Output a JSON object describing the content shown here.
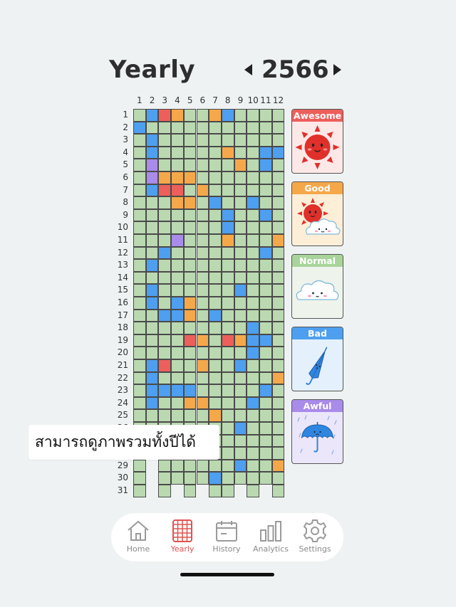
{
  "header": {
    "title": "Yearly",
    "year": "2566"
  },
  "colors": {
    "awesome": "#ed5f5b",
    "good": "#f5a84a",
    "normal": "#a8d49b",
    "bad": "#4e9ff0",
    "awful": "#a98bea",
    "cell_default": "#bad9b1"
  },
  "grid": {
    "month_labels": [
      "1",
      "2",
      "3",
      "4",
      "5",
      "6",
      "7",
      "8",
      "9",
      "10",
      "11",
      "12"
    ],
    "day_labels": [
      "1",
      "2",
      "3",
      "4",
      "5",
      "6",
      "7",
      "8",
      "9",
      "10",
      "11",
      "12",
      "13",
      "14",
      "15",
      "16",
      "17",
      "18",
      "19",
      "20",
      "21",
      "22",
      "23",
      "24",
      "25",
      "26",
      "27",
      "28",
      "29",
      "30",
      "31"
    ],
    "days_in_month": [
      31,
      28,
      31,
      30,
      31,
      30,
      31,
      31,
      30,
      31,
      30,
      31
    ],
    "moods": [
      [
        "G",
        "B",
        "G",
        "G",
        "G",
        "G",
        "G",
        "G",
        "G",
        "G",
        "G",
        "G",
        "G",
        "G",
        "G",
        "G",
        "G",
        "G",
        "G",
        "G",
        "G",
        "G",
        "G",
        "G",
        "G",
        "G",
        "G",
        "G",
        "G",
        "G",
        "G"
      ],
      [
        "B",
        "G",
        "B",
        "B",
        "P",
        "P",
        "B",
        "G",
        "G",
        "G",
        "G",
        "G",
        "B",
        "G",
        "B",
        "B",
        "G",
        "G",
        "G",
        "G",
        "B",
        "B",
        "B",
        "B",
        "G",
        "G",
        "G",
        "G",
        "B",
        "B",
        "G"
      ],
      [
        "A",
        "G",
        "G",
        "G",
        "G",
        "O",
        "A",
        "G",
        "G",
        "G",
        "G",
        "B",
        "G",
        "G",
        "G",
        "G",
        "B",
        "G",
        "G",
        "G",
        "A",
        "G",
        "B",
        "G",
        "G",
        "G",
        "G",
        "G",
        "G",
        "G",
        "G"
      ],
      [
        "O",
        "G",
        "G",
        "G",
        "G",
        "O",
        "A",
        "O",
        "G",
        "G",
        "P",
        "G",
        "G",
        "G",
        "G",
        "B",
        "B",
        "G",
        "G",
        "G",
        "G",
        "G",
        "B",
        "G",
        "G",
        "G",
        "G",
        "G",
        "G",
        "G",
        "G"
      ],
      [
        "G",
        "G",
        "G",
        "G",
        "G",
        "O",
        "G",
        "O",
        "G",
        "G",
        "G",
        "G",
        "G",
        "G",
        "G",
        "O",
        "O",
        "G",
        "A",
        "G",
        "G",
        "G",
        "B",
        "O",
        "G",
        "G",
        "G",
        "G",
        "G",
        "G",
        "G"
      ],
      [
        "G",
        "G",
        "G",
        "G",
        "G",
        "G",
        "O",
        "G",
        "G",
        "G",
        "G",
        "G",
        "G",
        "G",
        "G",
        "G",
        "G",
        "G",
        "O",
        "G",
        "O",
        "G",
        "G",
        "O",
        "G",
        "G",
        "G",
        "G",
        "G",
        "G",
        "G"
      ],
      [
        "O",
        "G",
        "G",
        "G",
        "G",
        "G",
        "G",
        "B",
        "G",
        "G",
        "G",
        "G",
        "G",
        "G",
        "G",
        "G",
        "B",
        "G",
        "G",
        "G",
        "G",
        "G",
        "G",
        "G",
        "O",
        "G",
        "G",
        "G",
        "G",
        "B",
        "G"
      ],
      [
        "B",
        "G",
        "G",
        "O",
        "G",
        "G",
        "G",
        "G",
        "B",
        "B",
        "O",
        "G",
        "G",
        "G",
        "G",
        "G",
        "G",
        "G",
        "A",
        "G",
        "G",
        "G",
        "G",
        "G",
        "G",
        "G",
        "G",
        "G",
        "G",
        "G",
        "G"
      ],
      [
        "G",
        "G",
        "G",
        "G",
        "O",
        "G",
        "G",
        "G",
        "G",
        "G",
        "G",
        "G",
        "G",
        "G",
        "B",
        "G",
        "G",
        "G",
        "O",
        "G",
        "B",
        "G",
        "G",
        "G",
        "G",
        "B",
        "G",
        "G",
        "B",
        "G",
        "G"
      ],
      [
        "G",
        "G",
        "G",
        "G",
        "G",
        "G",
        "G",
        "B",
        "G",
        "G",
        "G",
        "G",
        "G",
        "G",
        "G",
        "G",
        "G",
        "B",
        "B",
        "B",
        "G",
        "G",
        "G",
        "B",
        "G",
        "G",
        "G",
        "G",
        "G",
        "G",
        "G"
      ],
      [
        "G",
        "G",
        "G",
        "B",
        "B",
        "G",
        "G",
        "G",
        "B",
        "G",
        "G",
        "B",
        "G",
        "G",
        "G",
        "G",
        "G",
        "G",
        "B",
        "G",
        "G",
        "G",
        "B",
        "G",
        "G",
        "G",
        "G",
        "G",
        "G",
        "G",
        "G"
      ],
      [
        "G",
        "G",
        "G",
        "B",
        "G",
        "G",
        "G",
        "G",
        "G",
        "G",
        "O",
        "G",
        "G",
        "G",
        "G",
        "G",
        "G",
        "G",
        "G",
        "G",
        "G",
        "O",
        "G",
        "G",
        "G",
        "G",
        "G",
        "G",
        "O",
        "G",
        "G"
      ]
    ]
  },
  "legend": [
    {
      "key": "awesome",
      "label": "Awesome"
    },
    {
      "key": "good",
      "label": "Good"
    },
    {
      "key": "normal",
      "label": "Normal"
    },
    {
      "key": "bad",
      "label": "Bad"
    },
    {
      "key": "awful",
      "label": "Awful"
    }
  ],
  "toast": {
    "text": "สามารถดูภาพรวมทั้งปีได้"
  },
  "tabbar": {
    "tabs": [
      {
        "label": "Home",
        "icon": "home-icon"
      },
      {
        "label": "Yearly",
        "icon": "calendar-grid-icon",
        "active": true
      },
      {
        "label": "History",
        "icon": "history-calendar-icon"
      },
      {
        "label": "Analytics",
        "icon": "bar-chart-icon"
      },
      {
        "label": "Settings",
        "icon": "gear-icon"
      }
    ]
  }
}
